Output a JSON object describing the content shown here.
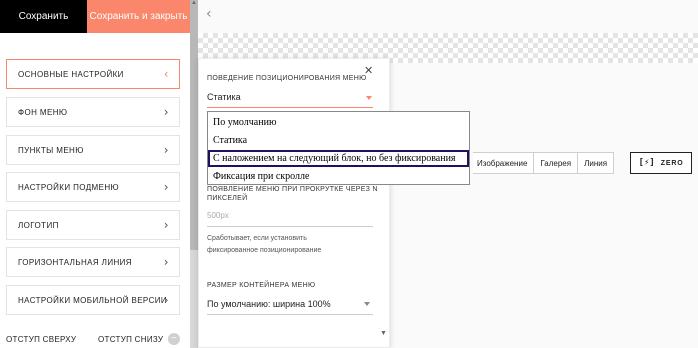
{
  "header": {
    "save_label": "Сохранить",
    "save_close_label": "Сохранить и закрыть"
  },
  "sidebar": {
    "items": [
      {
        "label": "ОСНОВНЫЕ НАСТРОЙКИ",
        "active": true
      },
      {
        "label": "ФОН МЕНЮ",
        "active": false
      },
      {
        "label": "ПУНКТЫ МЕНЮ",
        "active": false
      },
      {
        "label": "НАСТРОЙКИ ПОДМЕНЮ",
        "active": false
      },
      {
        "label": "ЛОГОТИП",
        "active": false
      },
      {
        "label": "ГОРИЗОНТАЛЬНАЯ ЛИНИЯ",
        "active": false
      },
      {
        "label": "НАСТРОЙКИ МОБИЛЬНОЙ ВЕРСИИ",
        "active": false
      }
    ],
    "chevron_icon": "chevron-right-icon",
    "bottom": {
      "padding_top_label": "ОТСТУП СВЕРХУ",
      "padding_bottom_label": "ОТСТУП СНИЗУ"
    }
  },
  "canvas": {
    "back_icon": "chevron-left-icon",
    "toolbar": {
      "image_label": "Изображение",
      "gallery_label": "Галерея",
      "line_label": "Линия",
      "zero_label": "ZERO"
    }
  },
  "popup": {
    "positioning": {
      "label": "ПОВЕДЕНИЕ ПОЗИЦИОНИРОВАНИЯ МЕНЮ",
      "value": "Статика"
    },
    "show_after": {
      "label_line1": "ПОЯВЛЕНИЕ МЕНЮ ПРИ ПРОКРУТКЕ ЧЕРЕЗ N",
      "label_line2": "ПИКСЕЛЕЙ",
      "placeholder": "500px",
      "help_line1": "Сработывает, если установить",
      "help_line2": "фиксированное позиционирование"
    },
    "container_size": {
      "label": "РАЗМЕР КОНТЕЙНЕРА МЕНЮ",
      "value": "По умолчанию: ширина 100%"
    }
  },
  "dropdown": {
    "options": [
      {
        "label": "По умолчанию",
        "selected": false
      },
      {
        "label": "Статика",
        "selected": false
      },
      {
        "label": "С наложением на следующий блок, но без фиксирования",
        "selected": true
      },
      {
        "label": "Фиксация при скролле",
        "selected": false
      }
    ]
  },
  "colors": {
    "accent": "#fa876b",
    "selected_border": "#1c1262"
  }
}
